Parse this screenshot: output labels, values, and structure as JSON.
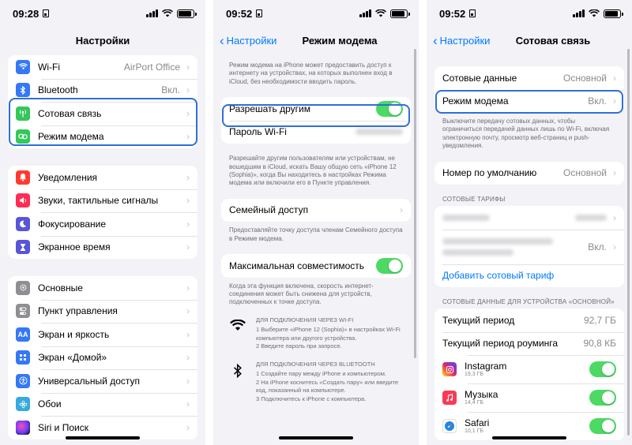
{
  "screen1": {
    "status": {
      "time": "09:28"
    },
    "title": "Настройки",
    "group1": [
      {
        "label": "Wi-Fi",
        "value": "AirPort Office",
        "icon": "wifi-icon",
        "color": "#3478f6"
      },
      {
        "label": "Bluetooth",
        "value": "Вкл.",
        "icon": "bluetooth-icon",
        "color": "#3478f6"
      },
      {
        "label": "Сотовая связь",
        "value": "",
        "icon": "antenna-icon",
        "color": "#34c759"
      },
      {
        "label": "Режим модема",
        "value": "",
        "icon": "link-icon",
        "color": "#34c759"
      }
    ],
    "group2": [
      {
        "label": "Уведомления",
        "icon": "bell-icon",
        "color": "#ff3b30"
      },
      {
        "label": "Звуки, тактильные сигналы",
        "icon": "speaker-icon",
        "color": "#ff2d55"
      },
      {
        "label": "Фокусирование",
        "icon": "moon-icon",
        "color": "#5856d6"
      },
      {
        "label": "Экранное время",
        "icon": "hourglass-icon",
        "color": "#5856d6"
      }
    ],
    "group3": [
      {
        "label": "Основные",
        "icon": "gear-icon",
        "color": "#8e8e93"
      },
      {
        "label": "Пункт управления",
        "icon": "switches-icon",
        "color": "#8e8e93"
      },
      {
        "label": "Экран и яркость",
        "icon": "aa-icon",
        "color": "#3478f6"
      },
      {
        "label": "Экран «Домой»",
        "icon": "grid-icon",
        "color": "#3478f6"
      },
      {
        "label": "Универсальный доступ",
        "icon": "accessibility-icon",
        "color": "#3478f6"
      },
      {
        "label": "Обои",
        "icon": "flower-icon",
        "color": "#36aadc"
      },
      {
        "label": "Siri и Поиск",
        "icon": "siri-icon",
        "color": "#222"
      }
    ]
  },
  "screen2": {
    "status": {
      "time": "09:52"
    },
    "back": "Настройки",
    "title": "Режим модема",
    "intro": "Режим модема на iPhone может предоставить доступ к интернету на устройствах, на которых выполнен вход в iCloud, без необходимости вводить пароль.",
    "allow_label": "Разрешать другим",
    "wifi_pass_label": "Пароль Wi-Fi",
    "allow_note": "Разрешайте другим пользователям или устройствам, не вошедшим в iCloud, искать Вашу общую сеть «iPhone 12 (Sophia)», когда Вы находитесь в настройках Режима модема или включили его в Пункте управления.",
    "family_label": "Семейный доступ",
    "family_note": "Предоставляйте точку доступа членам Семейного доступа в Режиме модема.",
    "max_compat_label": "Максимальная совместимость",
    "max_compat_note": "Когда эта функция включена, скорость интернет-соединения может быть снижена для устройств, подключенных к точке доступа.",
    "wifi_instr": {
      "header": "ДЛЯ ПОДКЛЮЧЕНИЯ ЧЕРЕЗ WI-FI",
      "step1": "1 Выберите «iPhone 12 (Sophia)» в настройках Wi-Fi компьютера или другого устройства.",
      "step2": "2 Введите пароль при запросе."
    },
    "bt_instr": {
      "header": "ДЛЯ ПОДКЛЮЧЕНИЯ ЧЕРЕЗ BLUETOOTH",
      "step1": "1 Создайте пару между iPhone и компьютером.",
      "step2": "2 На iPhone коснитесь «Создать пару» или введите код, показанный на компьютере.",
      "step3": "3 Подключитесь к iPhone с компьютера."
    }
  },
  "screen3": {
    "status": {
      "time": "09:52"
    },
    "back": "Настройки",
    "title": "Сотовая связь",
    "cellular_data_label": "Сотовые данные",
    "cellular_data_value": "Основной",
    "hotspot_label": "Режим модема",
    "hotspot_value": "Вкл.",
    "note": "Выключите передачу сотовых данных, чтобы ограничиться передачей данных лишь по Wi-Fi, включая электронную почту, просмотр веб-страниц и push-уведомления.",
    "default_number_label": "Номер по умолчанию",
    "default_number_value": "Основной",
    "plans_header": "СОТОВЫЕ ТАРИФЫ",
    "plan_value": "Вкл.",
    "add_plan": "Добавить сотовый тариф",
    "usage_header": "СОТОВЫЕ ДАННЫЕ ДЛЯ УСТРОЙСТВА «ОСНОВНОЙ»",
    "current_period_label": "Текущий период",
    "current_period_value": "92,7 ГБ",
    "roaming_label": "Текущий период роуминга",
    "roaming_value": "90,8 КБ",
    "apps": [
      {
        "name": "Instagram",
        "size": "19,3 ГБ",
        "color": "#d62976"
      },
      {
        "name": "Музыка",
        "size": "14,4 ГБ",
        "color": "#fa3a55"
      },
      {
        "name": "Safari",
        "size": "10,1 ГБ",
        "color": "#1e88e5"
      }
    ]
  }
}
